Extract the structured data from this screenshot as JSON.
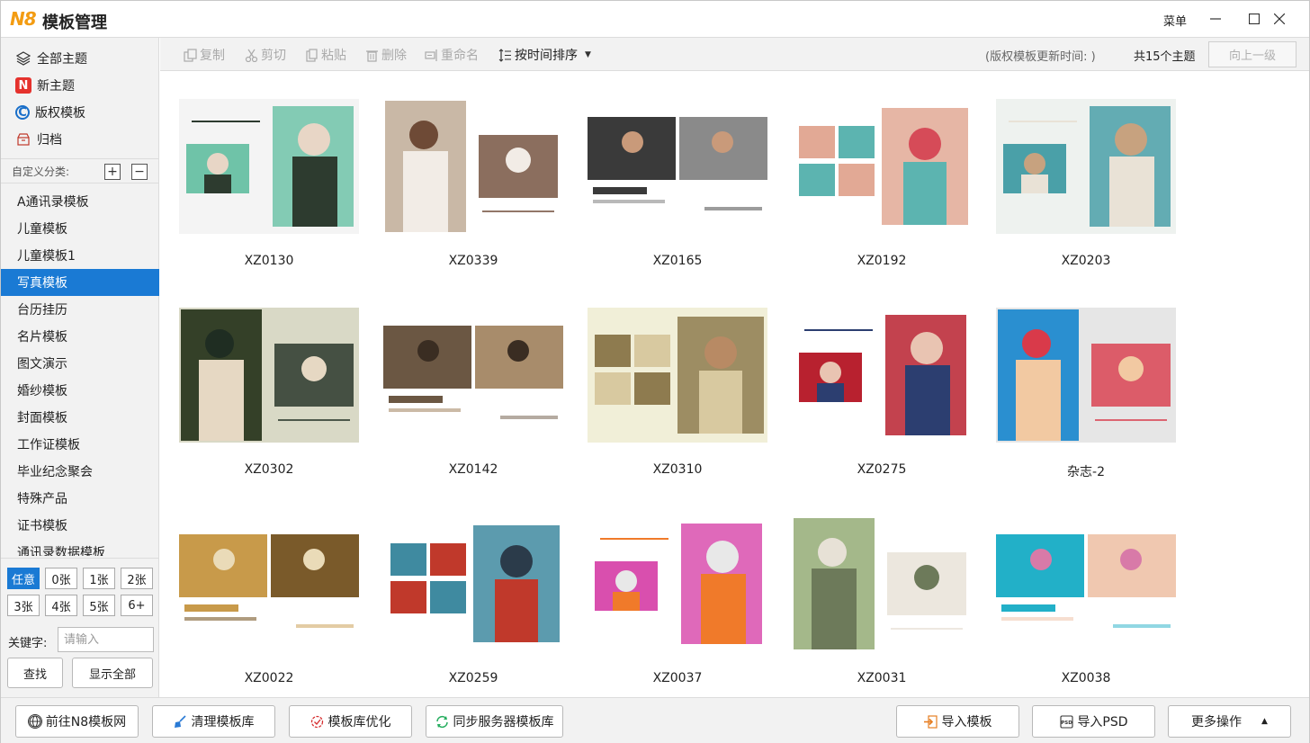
{
  "app": {
    "logo": "N8",
    "title": "模板管理",
    "menu_label": "菜单"
  },
  "sidebar": {
    "top_items": [
      {
        "label": "全部主题",
        "icon": "layers-icon"
      },
      {
        "label": "新主题",
        "icon": "new-badge-icon"
      },
      {
        "label": "版权模板",
        "icon": "copyright-icon"
      },
      {
        "label": "归档",
        "icon": "archive-box-icon"
      }
    ],
    "custom_label": "自定义分类:",
    "add_symbol": "+",
    "remove_symbol": "−",
    "categories": [
      {
        "label": "A通讯录模板",
        "selected": false
      },
      {
        "label": "儿童模板",
        "selected": false
      },
      {
        "label": "儿童模板1",
        "selected": false
      },
      {
        "label": "写真模板",
        "selected": true
      },
      {
        "label": "台历挂历",
        "selected": false
      },
      {
        "label": "名片模板",
        "selected": false
      },
      {
        "label": "图文演示",
        "selected": false
      },
      {
        "label": "婚纱模板",
        "selected": false
      },
      {
        "label": "封面模板",
        "selected": false
      },
      {
        "label": "工作证模板",
        "selected": false
      },
      {
        "label": "毕业纪念聚会",
        "selected": false
      },
      {
        "label": "特殊产品",
        "selected": false
      },
      {
        "label": "证书模板",
        "selected": false
      },
      {
        "label": "通讯录数据模板",
        "selected": false
      }
    ],
    "page_filters": [
      {
        "label": "任意",
        "selected": true
      },
      {
        "label": "0张",
        "selected": false
      },
      {
        "label": "1张",
        "selected": false
      },
      {
        "label": "2张",
        "selected": false
      },
      {
        "label": "3张",
        "selected": false
      },
      {
        "label": "4张",
        "selected": false
      },
      {
        "label": "5张",
        "selected": false
      },
      {
        "label": "6+",
        "selected": false
      }
    ],
    "keyword_label": "关键字:",
    "keyword_placeholder": "请输入",
    "keyword_value": "",
    "search_button": "查找",
    "show_all_button": "显示全部"
  },
  "toolbar": {
    "copy": "复制",
    "cut": "剪切",
    "paste": "粘贴",
    "delete": "删除",
    "rename": "重命名",
    "sort": "按时间排序",
    "update_info": "(版权模板更新时间: )",
    "count_info": "共15个主题",
    "up_button": "向上一级"
  },
  "templates": [
    {
      "name": "XZ0130",
      "palette": [
        "#f4f4f4",
        "#6fc3a8",
        "#2d3b2f",
        "#e8d6c6"
      ]
    },
    {
      "name": "XZ0339",
      "palette": [
        "#ffffff",
        "#c9b8a6",
        "#6e4a36",
        "#f2ece6"
      ]
    },
    {
      "name": "XZ0165",
      "palette": [
        "#ffffff",
        "#3a3a3a",
        "#8a8a8a",
        "#c99a7a"
      ]
    },
    {
      "name": "XZ0192",
      "palette": [
        "#ffffff",
        "#e2a995",
        "#5cb4b0",
        "#d64b58"
      ]
    },
    {
      "name": "XZ0203",
      "palette": [
        "#eef2ef",
        "#4aa0a8",
        "#e9e2d6",
        "#c7a27f"
      ]
    },
    {
      "name": "XZ0302",
      "palette": [
        "#d9d9c6",
        "#344028",
        "#1f2d22",
        "#e6d8c3"
      ]
    },
    {
      "name": "XZ0142",
      "palette": [
        "#ffffff",
        "#6b5743",
        "#a88c6b",
        "#3a2d22"
      ]
    },
    {
      "name": "XZ0310",
      "palette": [
        "#f1efd8",
        "#8e7b4f",
        "#d8c9a0",
        "#b88a64"
      ]
    },
    {
      "name": "XZ0275",
      "palette": [
        "#ffffff",
        "#b8212f",
        "#2c3e70",
        "#e9c4b2"
      ]
    },
    {
      "name": "杂志-2",
      "palette": [
        "#e6e6e6",
        "#2a8fd0",
        "#d93a4a",
        "#f2c9a2"
      ]
    },
    {
      "name": "XZ0022",
      "palette": [
        "#ffffff",
        "#c89a4a",
        "#7a5a2a",
        "#eadbb8"
      ]
    },
    {
      "name": "XZ0259",
      "palette": [
        "#ffffff",
        "#3f8aa0",
        "#c0392b",
        "#2b3b4a"
      ]
    },
    {
      "name": "XZ0037",
      "palette": [
        "#ffffff",
        "#d94fae",
        "#f07a2a",
        "#e8e8e8"
      ]
    },
    {
      "name": "XZ0031",
      "palette": [
        "#ffffff",
        "#a4b88a",
        "#e7e1d6",
        "#6d7a5a"
      ]
    },
    {
      "name": "XZ0038",
      "palette": [
        "#ffffff",
        "#22b0c8",
        "#f0c8b0",
        "#d87aa8"
      ]
    }
  ],
  "footer": {
    "goto_site": "前往N8模板网",
    "clean": "清理模板库",
    "optimize": "模板库优化",
    "sync": "同步服务器模板库",
    "import_template": "导入模板",
    "import_psd": "导入PSD",
    "more": "更多操作"
  }
}
